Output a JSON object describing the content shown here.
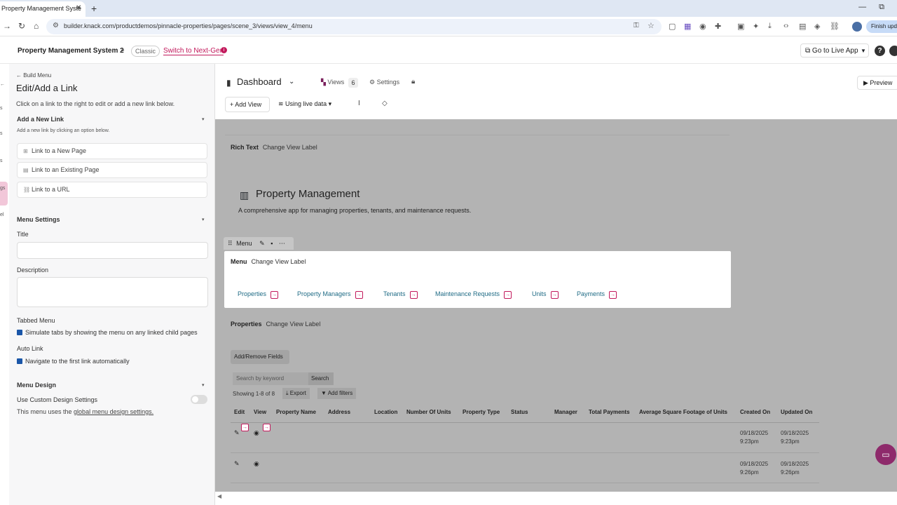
{
  "browser": {
    "tab_title": "Property Management Syste",
    "url": "builder.knack.com/productdemos/pinnacle-properties/pages/scene_3/views/view_4/menu",
    "finish_update": "Finish upda"
  },
  "app": {
    "name": "Property Management System 2",
    "classic_label": "Classic",
    "switch_label": "Switch to Next-Gen",
    "go_live_label": "Go to Live App",
    "help_label": "?"
  },
  "left_panel": {
    "back_label": "Build Menu",
    "title": "Edit/Add a Link",
    "subtitle": "Click on a link to the right to edit or add a new link below.",
    "add_section": {
      "header": "Add a New Link",
      "note": "Add a new link by clicking an option below.",
      "options": [
        "Link to a New Page",
        "Link to an Existing Page",
        "Link to a URL"
      ]
    },
    "menu_settings": {
      "header": "Menu Settings",
      "title_label": "Title",
      "title_value": "",
      "description_label": "Description",
      "description_value": "",
      "tabbed_label": "Tabbed Menu",
      "tabbed_checkbox": "Simulate tabs by showing the menu on any linked child pages",
      "autolink_label": "Auto Link",
      "autolink_checkbox": "Navigate to the first link automatically"
    },
    "menu_design": {
      "header": "Menu Design",
      "custom_label": "Use Custom Design Settings",
      "note_prefix": "This menu uses the ",
      "note_link": "global menu design settings."
    }
  },
  "toolbar": {
    "page_title": "Dashboard",
    "views_label": "Views",
    "views_count": "6",
    "settings_label": "Settings",
    "preview_label": "Preview",
    "add_view_label": "Add View",
    "live_data_label": "Using live data"
  },
  "canvas": {
    "rich_text": {
      "type_label": "Rich Text",
      "change_label": "Change View Label",
      "heading": "Property Management",
      "description": "A comprehensive app for managing properties, tenants, and maintenance requests."
    },
    "menu_view": {
      "tool_label": "Menu",
      "type_label": "Menu",
      "change_label": "Change View Label",
      "links": [
        "Properties",
        "Property Managers",
        "Tenants",
        "Maintenance Requests",
        "Units",
        "Payments"
      ]
    },
    "properties_view": {
      "type_label": "Properties",
      "change_label": "Change View Label",
      "add_remove_label": "Add/Remove Fields",
      "search_placeholder": "Search by keyword",
      "search_button": "Search",
      "showing": "Showing 1-8 of 8",
      "export_label": "Export",
      "filters_label": "Add filters",
      "columns": [
        "Edit",
        "View",
        "Property Name",
        "Address",
        "Location",
        "Number Of Units",
        "Property Type",
        "Status",
        "Manager",
        "Total Payments",
        "Average Square Footage of Units",
        "Created On",
        "Updated On"
      ],
      "rows": [
        {
          "created": "09/18/2025 9:23pm",
          "updated": "09/18/2025 9:23pm"
        },
        {
          "created": "09/18/2025 9:26pm",
          "updated": "09/18/2025 9:26pm"
        }
      ]
    }
  },
  "colors": {
    "accent": "#c2185b",
    "link": "#1f6b85",
    "canvas_bg": "#b3b3b3"
  }
}
